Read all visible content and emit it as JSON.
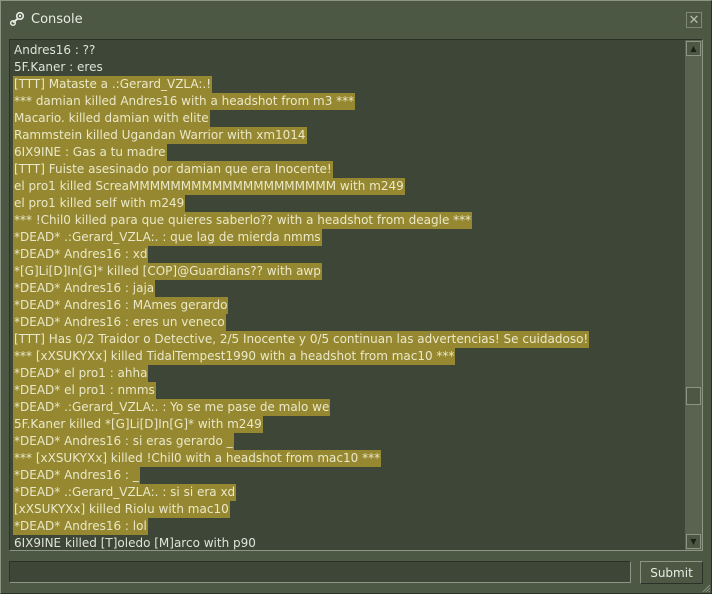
{
  "window": {
    "title": "Console",
    "close_glyph": "✕",
    "icon": "steam-icon"
  },
  "console": {
    "lines": [
      {
        "text": "Andres16 : ??",
        "highlight": false
      },
      {
        "text": "5F.Kaner : eres",
        "highlight": false
      },
      {
        "text": "[TTT] Mataste a .:Gerard_VZLA:.!",
        "highlight": true
      },
      {
        "text": "*** damian killed Andres16 with a headshot from m3 ***",
        "highlight": true
      },
      {
        "text": "Macario. killed damian with elite",
        "highlight": true
      },
      {
        "text": "Rammstein killed Ugandan Warrior with xm1014",
        "highlight": true
      },
      {
        "text": " 6IX9INE : Gas a tu madre",
        "highlight": true
      },
      {
        "text": "[TTT] Fuiste asesinado por damian que era Inocente!",
        "highlight": true
      },
      {
        "text": "el pro1 killed ScreaMMMMMMMMMMMMMMMMMMMM with m249",
        "highlight": true
      },
      {
        "text": "el pro1 killed self with m249",
        "highlight": true
      },
      {
        "text": "*** !Chil0 killed para que quieres saberlo?? with a headshot from deagle ***",
        "highlight": true
      },
      {
        "text": "*DEAD* .:Gerard_VZLA:. : que lag de mierda nmms",
        "highlight": true
      },
      {
        "text": "*DEAD* Andres16 : xd",
        "highlight": true
      },
      {
        "text": "*[G]Li[D]In[G]* killed [COP]@Guardians?? with awp",
        "highlight": true
      },
      {
        "text": "*DEAD* Andres16 : jaja",
        "highlight": true
      },
      {
        "text": "*DEAD* Andres16 : MAmes gerardo",
        "highlight": true
      },
      {
        "text": "*DEAD* Andres16 : eres un veneco",
        "highlight": true
      },
      {
        "text": "[TTT] Has 0/2 Traidor o Detective, 2/5 Inocente y 0/5 continuan las advertencias! Se cuidadoso!",
        "highlight": true
      },
      {
        "text": "*** [xXSUKYXx] killed TidalTempest1990 with a headshot from mac10 ***",
        "highlight": true
      },
      {
        "text": "*DEAD* el pro1 : ahha",
        "highlight": true
      },
      {
        "text": "*DEAD* el pro1 : nmms",
        "highlight": true
      },
      {
        "text": "*DEAD* .:Gerard_VZLA:. : Yo se me pase de malo we",
        "highlight": true
      },
      {
        "text": "5F.Kaner killed *[G]Li[D]In[G]* with m249",
        "highlight": true
      },
      {
        "text": "*DEAD* Andres16 : si eras gerardo _",
        "highlight": true
      },
      {
        "text": "*** [xXSUKYXx] killed !Chil0 with a headshot from mac10 ***",
        "highlight": true
      },
      {
        "text": "*DEAD* Andres16 : _",
        "highlight": true
      },
      {
        "text": "*DEAD* .:Gerard_VZLA:. : si si era xd",
        "highlight": true
      },
      {
        "text": "[xXSUKYXx] killed Riolu with mac10",
        "highlight": true
      },
      {
        "text": "*DEAD* Andres16 : lol",
        "highlight": true
      },
      {
        "text": "6IX9INE killed [T]oledo [M]arco with p90",
        "highlight": false
      }
    ],
    "scroll_position": 0.72
  },
  "input": {
    "value": "",
    "placeholder": ""
  },
  "submit_label": "Submit",
  "colors": {
    "window_bg": "#4c5844",
    "console_bg": "#3e4637",
    "highlight_bg": "#958831"
  }
}
